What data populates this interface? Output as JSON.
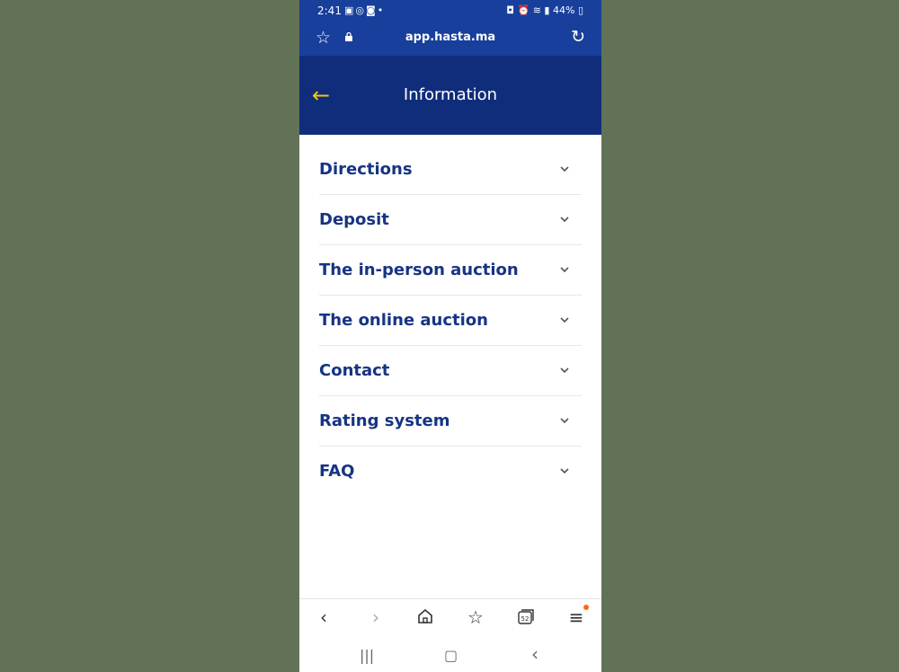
{
  "status_bar": {
    "time": "2:41",
    "left_icons": [
      "gallery-icon",
      "whatsapp-icon",
      "instagram-icon",
      "dot-icon"
    ],
    "right_text": "44%",
    "right_icons": [
      "lock-icon",
      "alarm-icon",
      "wifi-icon",
      "volte-icon",
      "signal-icon",
      "battery-icon"
    ]
  },
  "browser": {
    "url": "app.hasta.ma",
    "tabs_count": "52"
  },
  "header": {
    "title": "Information"
  },
  "sections": [
    {
      "label": "Directions"
    },
    {
      "label": "Deposit"
    },
    {
      "label": "The in-person auction"
    },
    {
      "label": "The online auction"
    },
    {
      "label": "Contact"
    },
    {
      "label": "Rating system"
    },
    {
      "label": "FAQ"
    }
  ],
  "colors": {
    "header_bg": "#102d7c",
    "browser_bg": "#173f9b",
    "accent": "#f2c318",
    "text": "#173484"
  }
}
